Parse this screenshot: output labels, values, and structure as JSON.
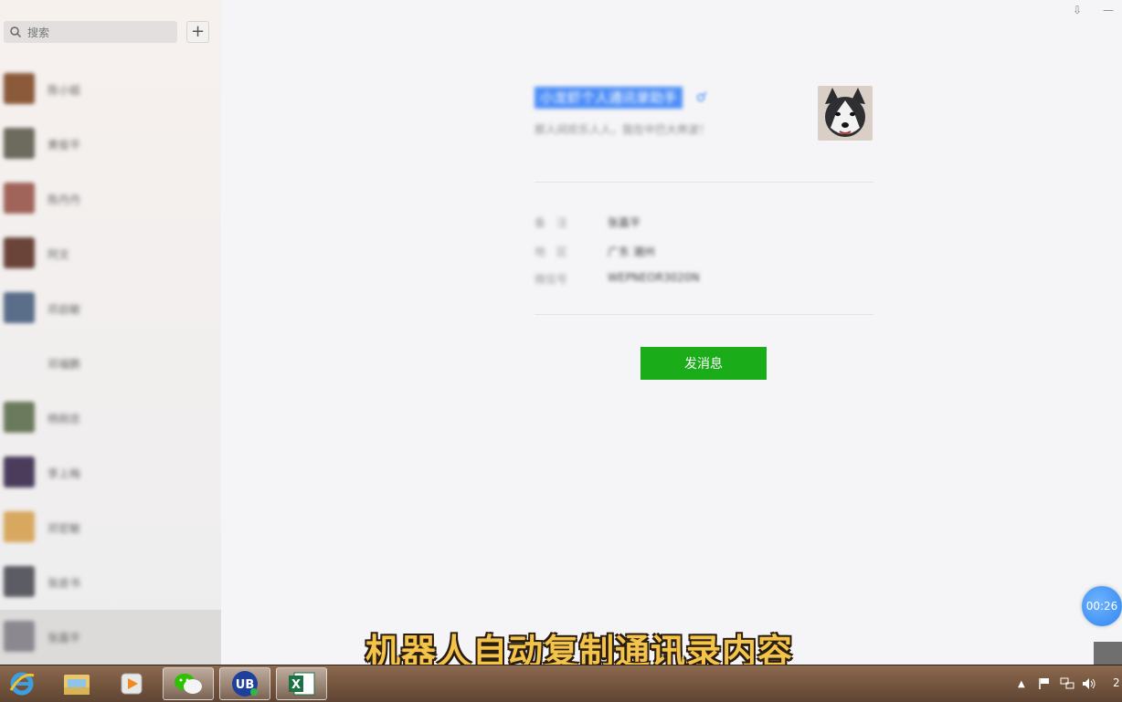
{
  "search": {
    "placeholder": "搜索",
    "add_label": "+"
  },
  "window": {
    "pin": "⇩",
    "minimize": "—"
  },
  "contacts": [
    {
      "name": "陈小姐",
      "color": "#8a5a3a"
    },
    {
      "name": "黄俊平",
      "color": "#6d6a5e"
    },
    {
      "name": "陈丹丹",
      "color": "#a0645a"
    },
    {
      "name": "阿文",
      "color": "#6a4438"
    },
    {
      "name": "邓启敏",
      "color": "#5a6e8a"
    },
    {
      "name": "邓福鹏",
      "color": "#f0eeee"
    },
    {
      "name": "杨刚忠",
      "color": "#6b7a5c"
    },
    {
      "name": "李上梅",
      "color": "#4b3c5c"
    },
    {
      "name": "邓宏敏",
      "color": "#d8a860"
    },
    {
      "name": "张皮书",
      "color": "#5c5c64"
    },
    {
      "name": "张嘉平",
      "color": "#8c8890"
    }
  ],
  "profile": {
    "name": "小龙虾个人通讯录助手",
    "signature": "那人间欢乐人人，我在中巴大奔波！",
    "fields": [
      {
        "label": "备　注",
        "value": "张嘉平"
      },
      {
        "label": "地　区",
        "value": "广东 潮州"
      },
      {
        "label": "微信号",
        "value": "WEPNEOR3020N"
      }
    ],
    "send_button": "发消息"
  },
  "caption": "机器人自动复制通讯录内容",
  "timer": "00:26",
  "taskbar": {
    "apps": [
      {
        "icon": "ie-icon"
      },
      {
        "icon": "explorer-icon"
      },
      {
        "icon": "media-player-icon"
      },
      {
        "icon": "wechat-icon"
      },
      {
        "icon": "uibot-icon",
        "text": "UB"
      },
      {
        "icon": "excel-icon",
        "text": "X"
      }
    ],
    "clock": "2"
  },
  "colors": {
    "accent": "#1aad19",
    "highlight": "#4f8ff7",
    "caption": "#f3c34a"
  }
}
